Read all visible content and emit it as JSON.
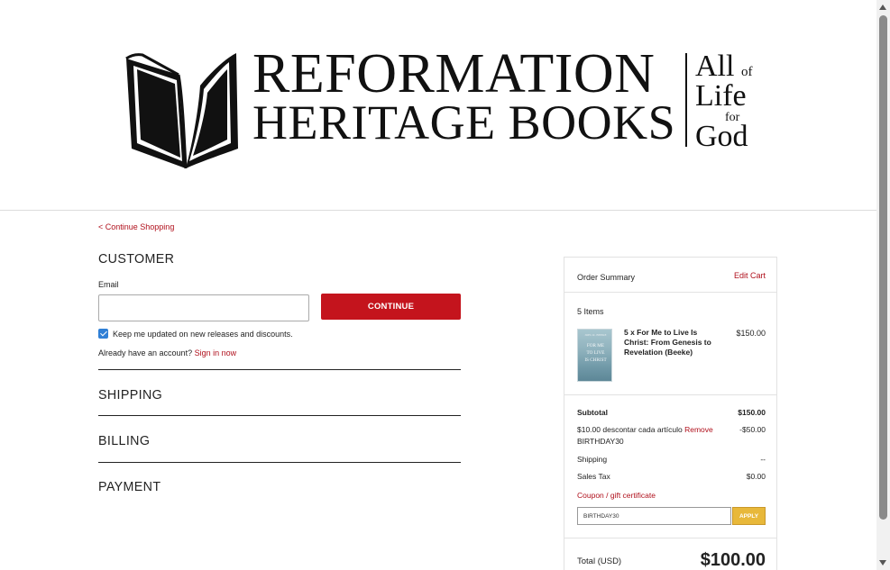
{
  "header": {
    "logo_line1": "REFORMATION",
    "logo_line2": "HERITAGE BOOKS",
    "tagline_all": "All",
    "tagline_of": "of",
    "tagline_life": "Life",
    "tagline_for": "for",
    "tagline_god": "God"
  },
  "nav": {
    "continue_shopping": "< Continue Shopping"
  },
  "customer": {
    "title": "CUSTOMER",
    "email_label": "Email",
    "email_value": "",
    "continue_button": "CONTINUE",
    "newsletter_checked": true,
    "newsletter_label": "Keep me updated on new releases and discounts.",
    "account_prompt": "Already have an account?",
    "sign_in_link": "Sign in now"
  },
  "sections": {
    "shipping": "SHIPPING",
    "billing": "BILLING",
    "payment": "PAYMENT"
  },
  "summary": {
    "title": "Order Summary",
    "edit_cart": "Edit Cart",
    "items_count": "5 Items",
    "item": {
      "name": "5 x For Me to Live Is Christ: From Genesis to Revelation (Beeke)",
      "price": "$150.00",
      "cover_author": "JOEL R. BEEKE",
      "cover_line1": "FOR ME",
      "cover_line2": "TO LIVE",
      "cover_line3": "IS CHRIST"
    },
    "subtotal_label": "Subtotal",
    "subtotal_value": "$150.00",
    "discount_label": "$10.00 descontar cada artículo",
    "discount_remove": "Remove",
    "discount_code": "BIRTHDAY30",
    "discount_value": "-$50.00",
    "shipping_label": "Shipping",
    "shipping_value": "--",
    "tax_label": "Sales Tax",
    "tax_value": "$0.00",
    "coupon_link": "Coupon / gift certificate",
    "coupon_value": "BIRTHDAY30",
    "apply_button": "APPLY",
    "total_label": "Total (USD)",
    "total_value": "$100.00"
  },
  "colors": {
    "brand_red": "#c4141d",
    "apply_yellow": "#e8b83a",
    "checkbox_blue": "#2f7fd6"
  }
}
